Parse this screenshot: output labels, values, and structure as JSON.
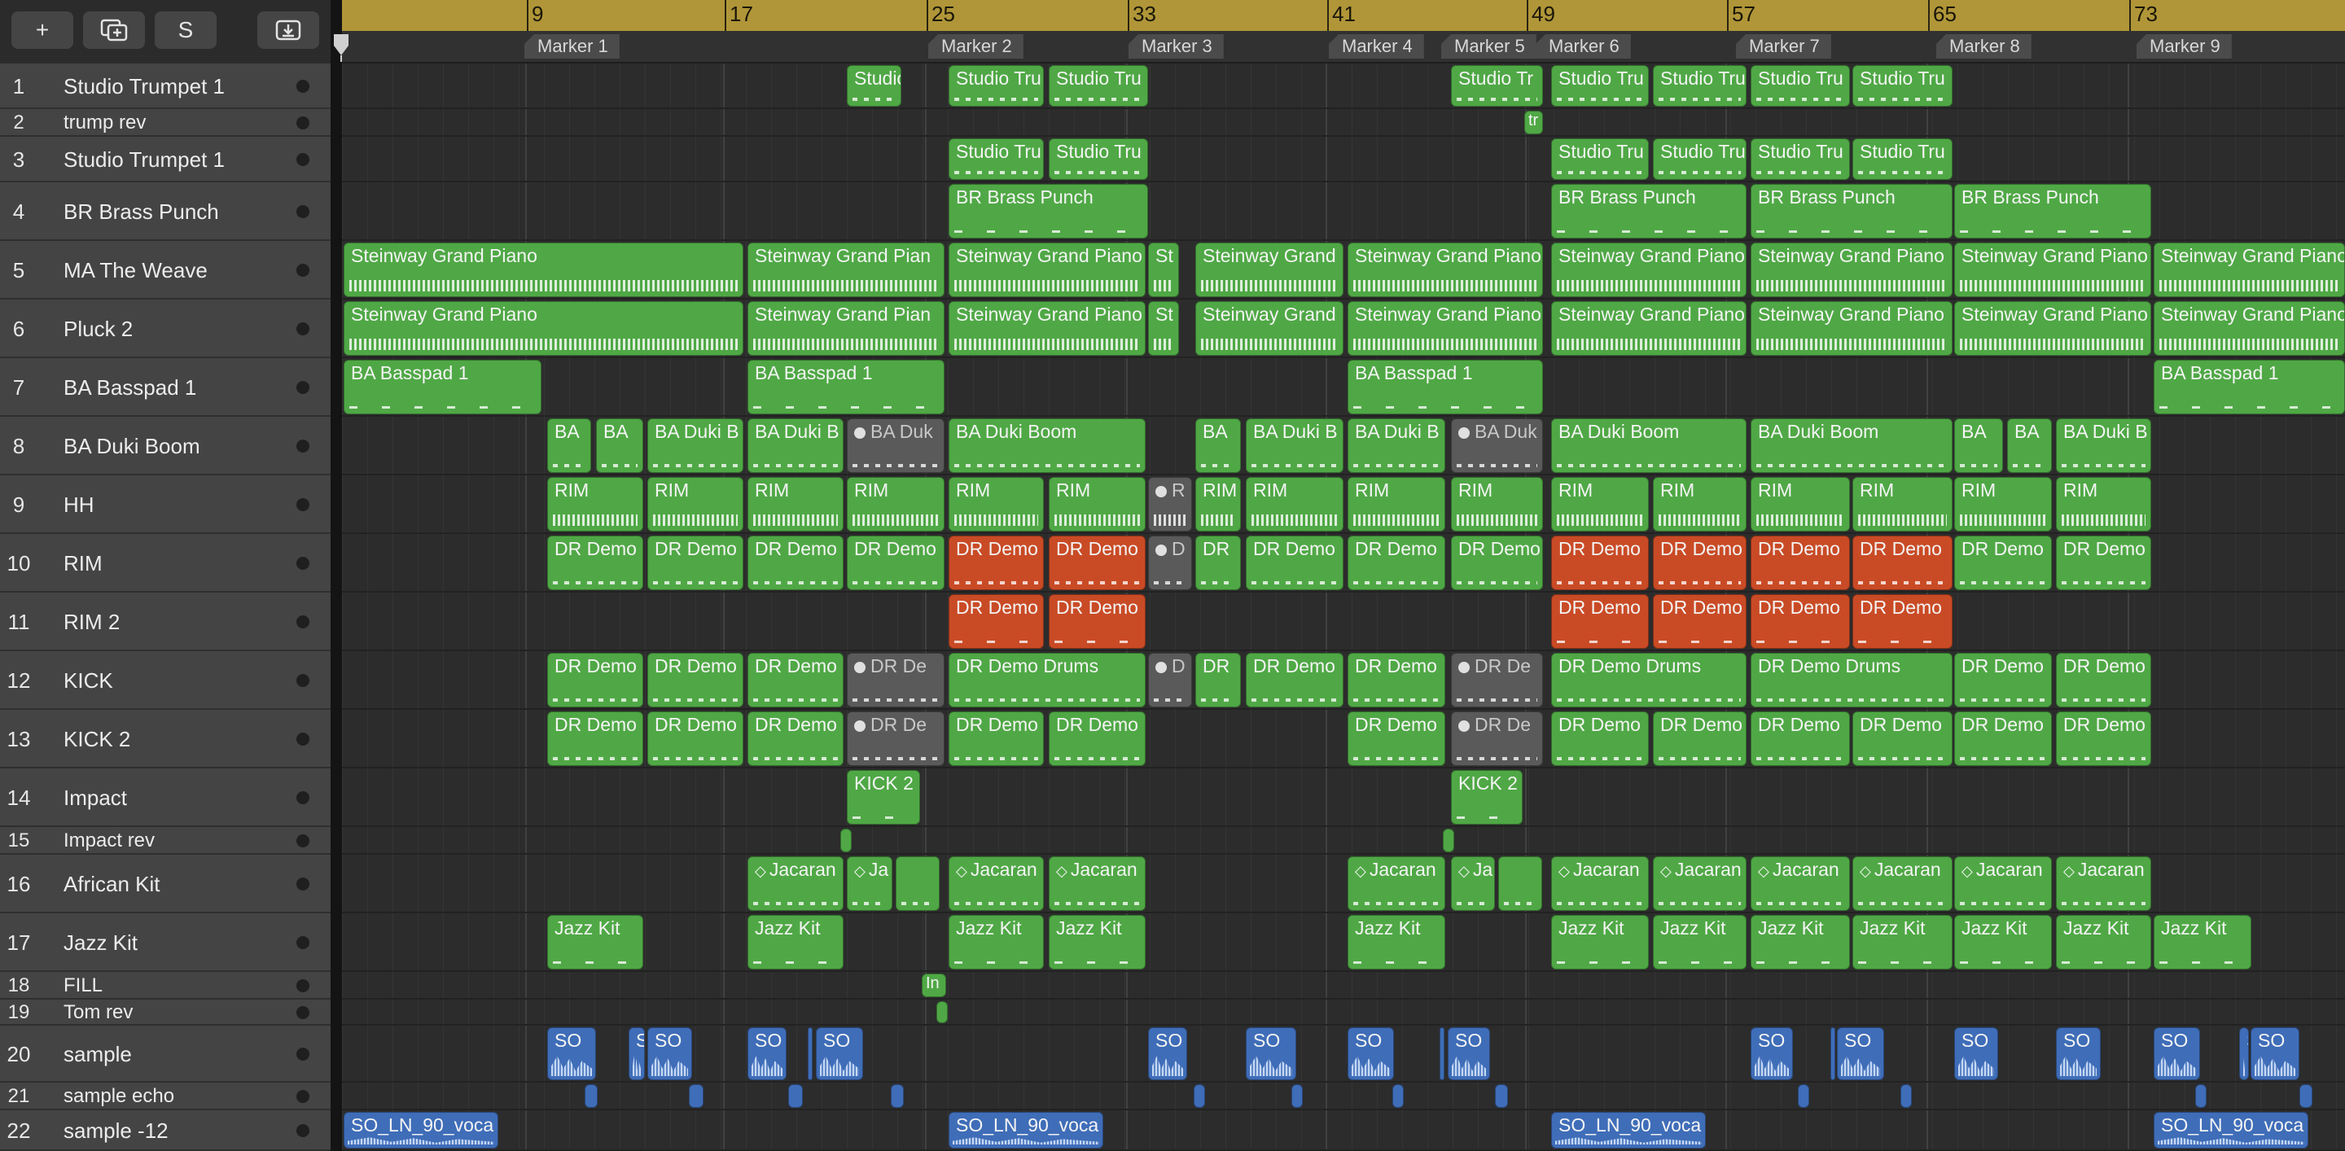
{
  "toolbar": {
    "add_label": "+",
    "solo_label": "S",
    "duplicate_icon": "duplicate-track-icon",
    "download_icon": "import-icon"
  },
  "ruler": {
    "bars": [
      "9",
      "17",
      "25",
      "33",
      "41",
      "49",
      "57",
      "65",
      "73"
    ]
  },
  "markers": [
    "Marker 1",
    "Marker 2",
    "Marker 3",
    "Marker 4",
    "Marker 5",
    "Marker 6",
    "Marker 7",
    "Marker 8",
    "Marker 9"
  ],
  "tracks": [
    {
      "num": "1",
      "name": "Studio Trumpet 1"
    },
    {
      "num": "2",
      "name": "trump rev"
    },
    {
      "num": "3",
      "name": "Studio Trumpet 1"
    },
    {
      "num": "4",
      "name": "BR Brass Punch"
    },
    {
      "num": "5",
      "name": "MA The Weave"
    },
    {
      "num": "6",
      "name": "Pluck 2"
    },
    {
      "num": "7",
      "name": "BA Basspad 1"
    },
    {
      "num": "8",
      "name": "BA Duki Boom"
    },
    {
      "num": "9",
      "name": "HH"
    },
    {
      "num": "10",
      "name": "RIM"
    },
    {
      "num": "11",
      "name": "RIM 2"
    },
    {
      "num": "12",
      "name": "KICK"
    },
    {
      "num": "13",
      "name": "KICK 2"
    },
    {
      "num": "14",
      "name": "Impact"
    },
    {
      "num": "15",
      "name": "Impact rev"
    },
    {
      "num": "16",
      "name": "African Kit"
    },
    {
      "num": "17",
      "name": "Jazz Kit"
    },
    {
      "num": "18",
      "name": "FILL"
    },
    {
      "num": "19",
      "name": "Tom rev"
    },
    {
      "num": "20",
      "name": "sample"
    },
    {
      "num": "21",
      "name": "sample echo"
    },
    {
      "num": "22",
      "name": "sample -12"
    }
  ],
  "region_names": {
    "trumpet_short": "Studio Tr",
    "trumpet": "Studio Tru",
    "trump_rev": "tr",
    "brass": "BR Brass Punch",
    "piano": "Steinway Grand Piano",
    "piano_a": "Steinway Grand Pian",
    "piano_b": "Steinway Grand",
    "piano_st": "St",
    "basspad": "BA Basspad 1",
    "duki_ba": "BA",
    "duki_b": "BA Duki B",
    "duki_gray": "BA Duk",
    "duki_boom": "BA Duki Boom",
    "rim": "RIM",
    "rim_r": "R",
    "dr_demo": "DR Demo",
    "dr": "DR",
    "d": "D",
    "dr_de": "DR De",
    "dr_demo_drums": "DR Demo Drums",
    "kick2": "KICK 2",
    "jacaran": "Jacaran",
    "ja": "Ja",
    "jazz_kit": "Jazz Kit",
    "fill_in": "In",
    "so": "SO",
    "vocal": "SO_LN_90_voca"
  },
  "colors": {
    "midi_region": "#4fa845",
    "muted_region": "#5a5a5a",
    "alt_region": "#c94b26",
    "audio_region": "#3f6db8",
    "ruler": "#b09638"
  }
}
